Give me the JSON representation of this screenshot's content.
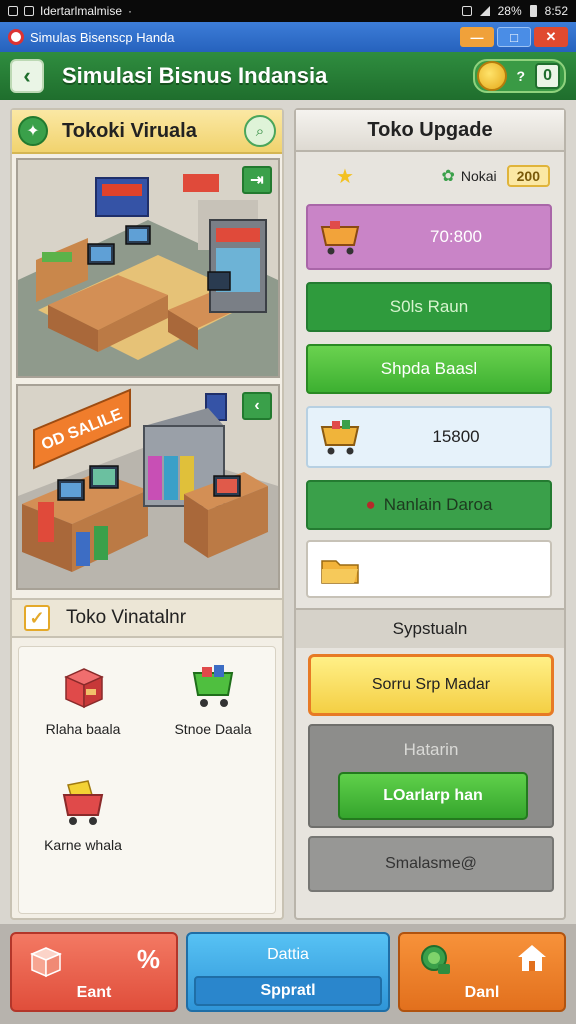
{
  "status_bar": {
    "left_text": "Idertarlmalmise",
    "left_extra": "·",
    "battery_text": "28%",
    "time": "8:52"
  },
  "title_bar": {
    "title": "Simulas Bisenscp Handa",
    "btn_min": "—",
    "btn_max": "□",
    "btn_close": "✕"
  },
  "header": {
    "back_label": "‹",
    "title": "Simulasi Bisnus Indansia",
    "coin_help": "?",
    "coin_value": "0"
  },
  "left_panel": {
    "title": "Tokoki Viruala",
    "scene1_btn": "⇥",
    "scene2_btn": "‹",
    "scene2_sign": "OD SALILE",
    "sub_title": "Toko Vinatalnr",
    "check_mark": "✓",
    "categories": [
      {
        "label": "Rlaha baala",
        "icon": "box-icon"
      },
      {
        "label": "Stnoe Daala",
        "icon": "cart-icon"
      },
      {
        "label": "Karne whala",
        "icon": "basket-icon"
      }
    ]
  },
  "right_panel": {
    "title": "Toko Upgade",
    "stat_label": "Nokai",
    "stat_value": "200",
    "rows": [
      {
        "text": "70:800",
        "icon": "cart-icon"
      },
      {
        "text": "S0ls Raun"
      },
      {
        "text": "Shpda Baasl"
      },
      {
        "text": "15800",
        "icon": "cart-icon"
      },
      {
        "text": "Nanlain Daroa",
        "icon": "pin-icon"
      },
      {
        "text": "",
        "icon": "folder-icon"
      }
    ],
    "section_title": "Sypstualn",
    "primary_button": "Sorru Srp Madar",
    "grey_box_title": "Hatarin",
    "grey_box_button": "LOarlarp han",
    "bottom_button": "Smalasme@"
  },
  "bottom_nav": {
    "left_label": "Eant",
    "left_percent": "%",
    "center_top": "Dattia",
    "center_bottom": "Sppratl",
    "right_label": "Danl"
  },
  "colors": {
    "header_green": "#2f8d3f",
    "title_blue": "#2662bd",
    "accent_yellow": "#f4cf44",
    "purple_row": "#c984c7"
  }
}
